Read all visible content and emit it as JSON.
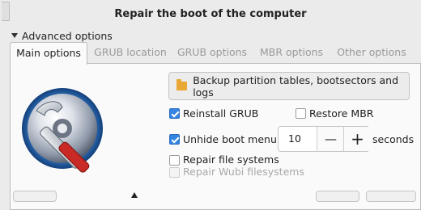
{
  "window": {
    "title": "Repair the boot of the computer"
  },
  "expander": {
    "label": "Advanced options",
    "expanded": true
  },
  "tabs": [
    {
      "label": "Main options",
      "active": true
    },
    {
      "label": "GRUB location",
      "active": false
    },
    {
      "label": "GRUB options",
      "active": false
    },
    {
      "label": "MBR options",
      "active": false
    },
    {
      "label": "Other options",
      "active": false
    }
  ],
  "main": {
    "backup_button": {
      "label": "Backup partition tables, bootsectors and logs",
      "icon": "folder-icon"
    },
    "reinstall_grub": {
      "label": "Reinstall GRUB",
      "checked": true
    },
    "restore_mbr": {
      "label": "Restore MBR",
      "checked": false
    },
    "unhide_boot_menu": {
      "label": "Unhide boot menu :",
      "checked": true,
      "value": "10",
      "unit": "seconds",
      "minus": "—",
      "plus": "+"
    },
    "repair_fs": {
      "label": "Repair file systems",
      "checked": false
    },
    "repair_wubi": {
      "label": "Repair Wubi filesystems",
      "checked": false,
      "enabled": false
    }
  },
  "colors": {
    "accent": "#3584e4",
    "folder": "#e9a833",
    "wrench": "#c92a26"
  }
}
